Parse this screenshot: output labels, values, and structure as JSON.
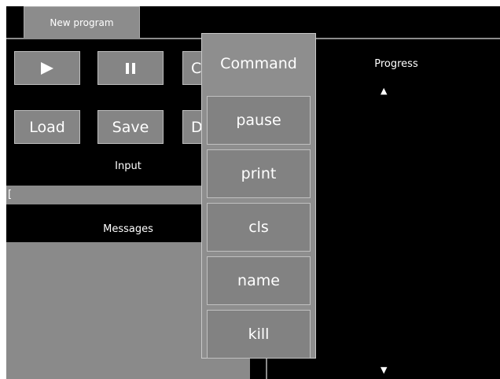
{
  "tab": {
    "label": "New program"
  },
  "controls": {
    "play_icon": "play-icon",
    "pause_icon": "pause-icon",
    "third_label": "C",
    "load_label": "Load",
    "save_label": "Save",
    "d_label": "D"
  },
  "input": {
    "title": "Input",
    "value": "["
  },
  "messages": {
    "title": "Messages"
  },
  "progress": {
    "title": "Progress",
    "up_arrow": "▲",
    "down_arrow": "▼"
  },
  "command_menu": {
    "title": "Command",
    "items": [
      "pause",
      "print",
      "cls",
      "name",
      "kill"
    ]
  }
}
